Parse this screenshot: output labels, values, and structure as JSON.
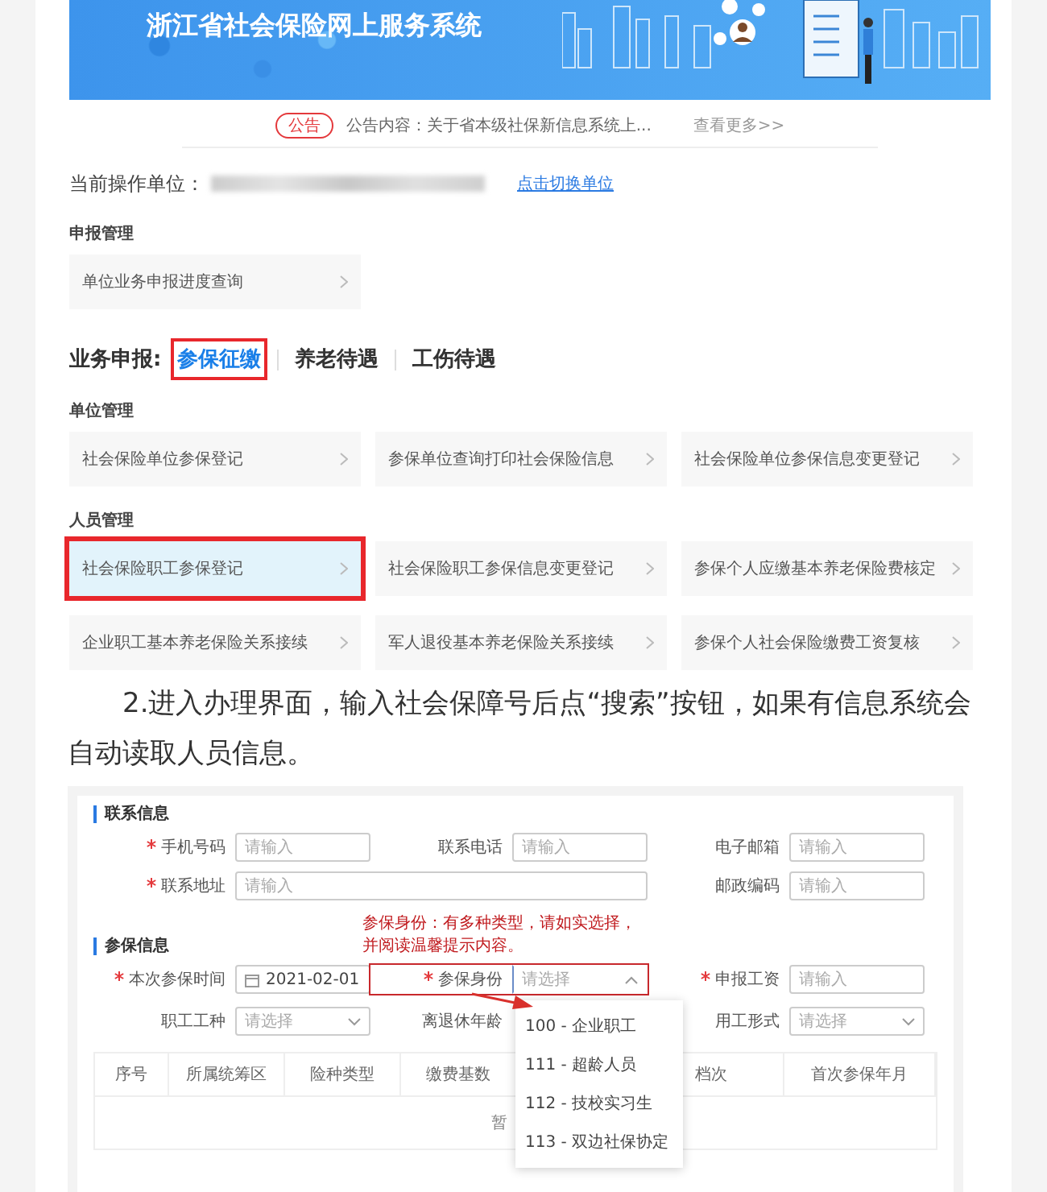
{
  "screenshot_1": {
    "banner_title": "浙江省社会保险网上服务系统",
    "notice": {
      "badge": "公告",
      "text": "公告内容：关于省本级社保新信息系统上...",
      "more": "查看更多>>"
    },
    "current_unit": {
      "label": "当前操作单位：",
      "link": "点击切换单位"
    },
    "top_sections": [
      {
        "heading": "申报管理",
        "items": [
          {
            "label": "单位业务申报进度查询",
            "selected": false,
            "highlighted": false
          }
        ]
      }
    ],
    "business_tabs": {
      "label": "业务申报:",
      "tabs": [
        {
          "label": "参保征缴",
          "selected": true,
          "highlighted": true
        },
        {
          "label": "养老待遇",
          "selected": false,
          "highlighted": false
        },
        {
          "label": "工伤待遇",
          "selected": false,
          "highlighted": false
        }
      ]
    },
    "tab_sections": [
      {
        "heading": "单位管理",
        "items": [
          {
            "label": "社会保险单位参保登记",
            "selected": false,
            "highlighted": false
          },
          {
            "label": "参保单位查询打印社会保险信息",
            "selected": false,
            "highlighted": false
          },
          {
            "label": "社会保险单位参保信息变更登记",
            "selected": false,
            "highlighted": false
          }
        ]
      },
      {
        "heading": "人员管理",
        "items": [
          {
            "label": "社会保险职工参保登记",
            "selected": true,
            "highlighted": true
          },
          {
            "label": "社会保险职工参保信息变更登记",
            "selected": false,
            "highlighted": false
          },
          {
            "label": "参保个人应缴基本养老保险费核定",
            "selected": false,
            "highlighted": false
          },
          {
            "label": "企业职工基本养老保险关系接续",
            "selected": false,
            "highlighted": false
          },
          {
            "label": "军人退役基本养老保险关系接续",
            "selected": false,
            "highlighted": false
          },
          {
            "label": "参保个人社会保险缴费工资复核",
            "selected": false,
            "highlighted": false
          }
        ]
      }
    ]
  },
  "paragraph": "2.进入办理界面，输入社会保障号后点“搜索”按钮，如果有信息系统会自动读取人员信息。",
  "screenshot_2": {
    "contact": {
      "heading": "联系信息",
      "fields": [
        {
          "label": "手机号码",
          "required": true,
          "kind": "input",
          "placeholder": "请输入"
        },
        {
          "label": "联系电话",
          "required": false,
          "kind": "input",
          "placeholder": "请输入"
        },
        {
          "label": "电子邮箱",
          "required": false,
          "kind": "input",
          "placeholder": "请输入"
        },
        {
          "label": "联系地址",
          "required": true,
          "kind": "wide",
          "placeholder": "请输入"
        },
        {
          "label": "邮政编码",
          "required": false,
          "kind": "input",
          "placeholder": "请输入"
        }
      ]
    },
    "annotation": [
      "参保身份：有多种类型，请如实选择，",
      "并阅读温馨提示内容。"
    ],
    "insurance": {
      "heading": "参保信息",
      "fields": [
        {
          "label": "本次参保时间",
          "required": true,
          "kind": "date",
          "value": "2021-02-01"
        },
        {
          "label": "参保身份",
          "required": true,
          "kind": "select",
          "placeholder": "请选择",
          "expanded": true,
          "highlighted": true,
          "options": [
            "100 - 企业职工",
            "111 - 超龄人员",
            "112 - 技校实习生",
            "113 - 双边社保协定"
          ]
        },
        {
          "label": "申报工资",
          "required": true,
          "kind": "input",
          "placeholder": "请输入"
        },
        {
          "label": "职工工种",
          "required": false,
          "kind": "select",
          "placeholder": "请选择",
          "expanded": false,
          "highlighted": false
        },
        {
          "label": "离退休年龄",
          "required": false,
          "kind": "covered"
        },
        {
          "label": "用工形式",
          "required": false,
          "kind": "select",
          "placeholder": "请选择",
          "expanded": false,
          "highlighted": false
        }
      ]
    },
    "table": {
      "columns": [
        "序号",
        "所属统筹区",
        "险种类型",
        "缴费基数",
        "",
        "档次",
        "首次参保年月"
      ],
      "empty_text": "暂"
    }
  }
}
